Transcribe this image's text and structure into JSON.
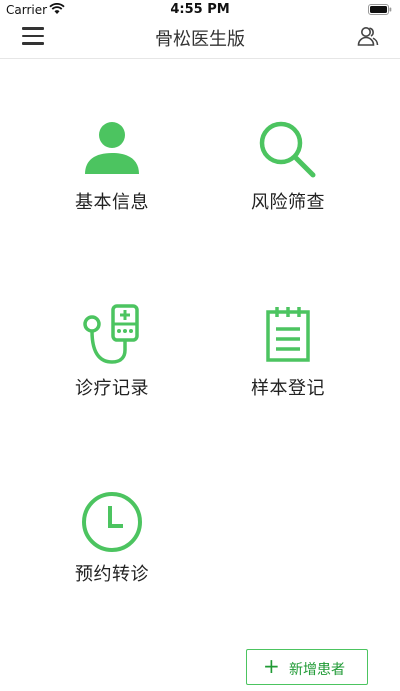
{
  "status_bar": {
    "carrier": "Carrier",
    "time": "4:55 PM"
  },
  "nav": {
    "title": "骨松医生版",
    "menu_icon": "hamburger-menu-icon",
    "user_icon": "users-icon"
  },
  "features": [
    {
      "label": "基本信息",
      "icon": "person-icon"
    },
    {
      "label": "风险筛查",
      "icon": "search-icon"
    },
    {
      "label": "诊疗记录",
      "icon": "stethoscope-icon"
    },
    {
      "label": "样本登记",
      "icon": "notepad-icon"
    },
    {
      "label": "预约转诊",
      "icon": "clock-icon"
    }
  ],
  "add_patient": {
    "label": "新增患者",
    "icon": "plus-icon"
  },
  "colors": {
    "accent": "#4cc460",
    "accent_dark": "#1f9a34"
  }
}
